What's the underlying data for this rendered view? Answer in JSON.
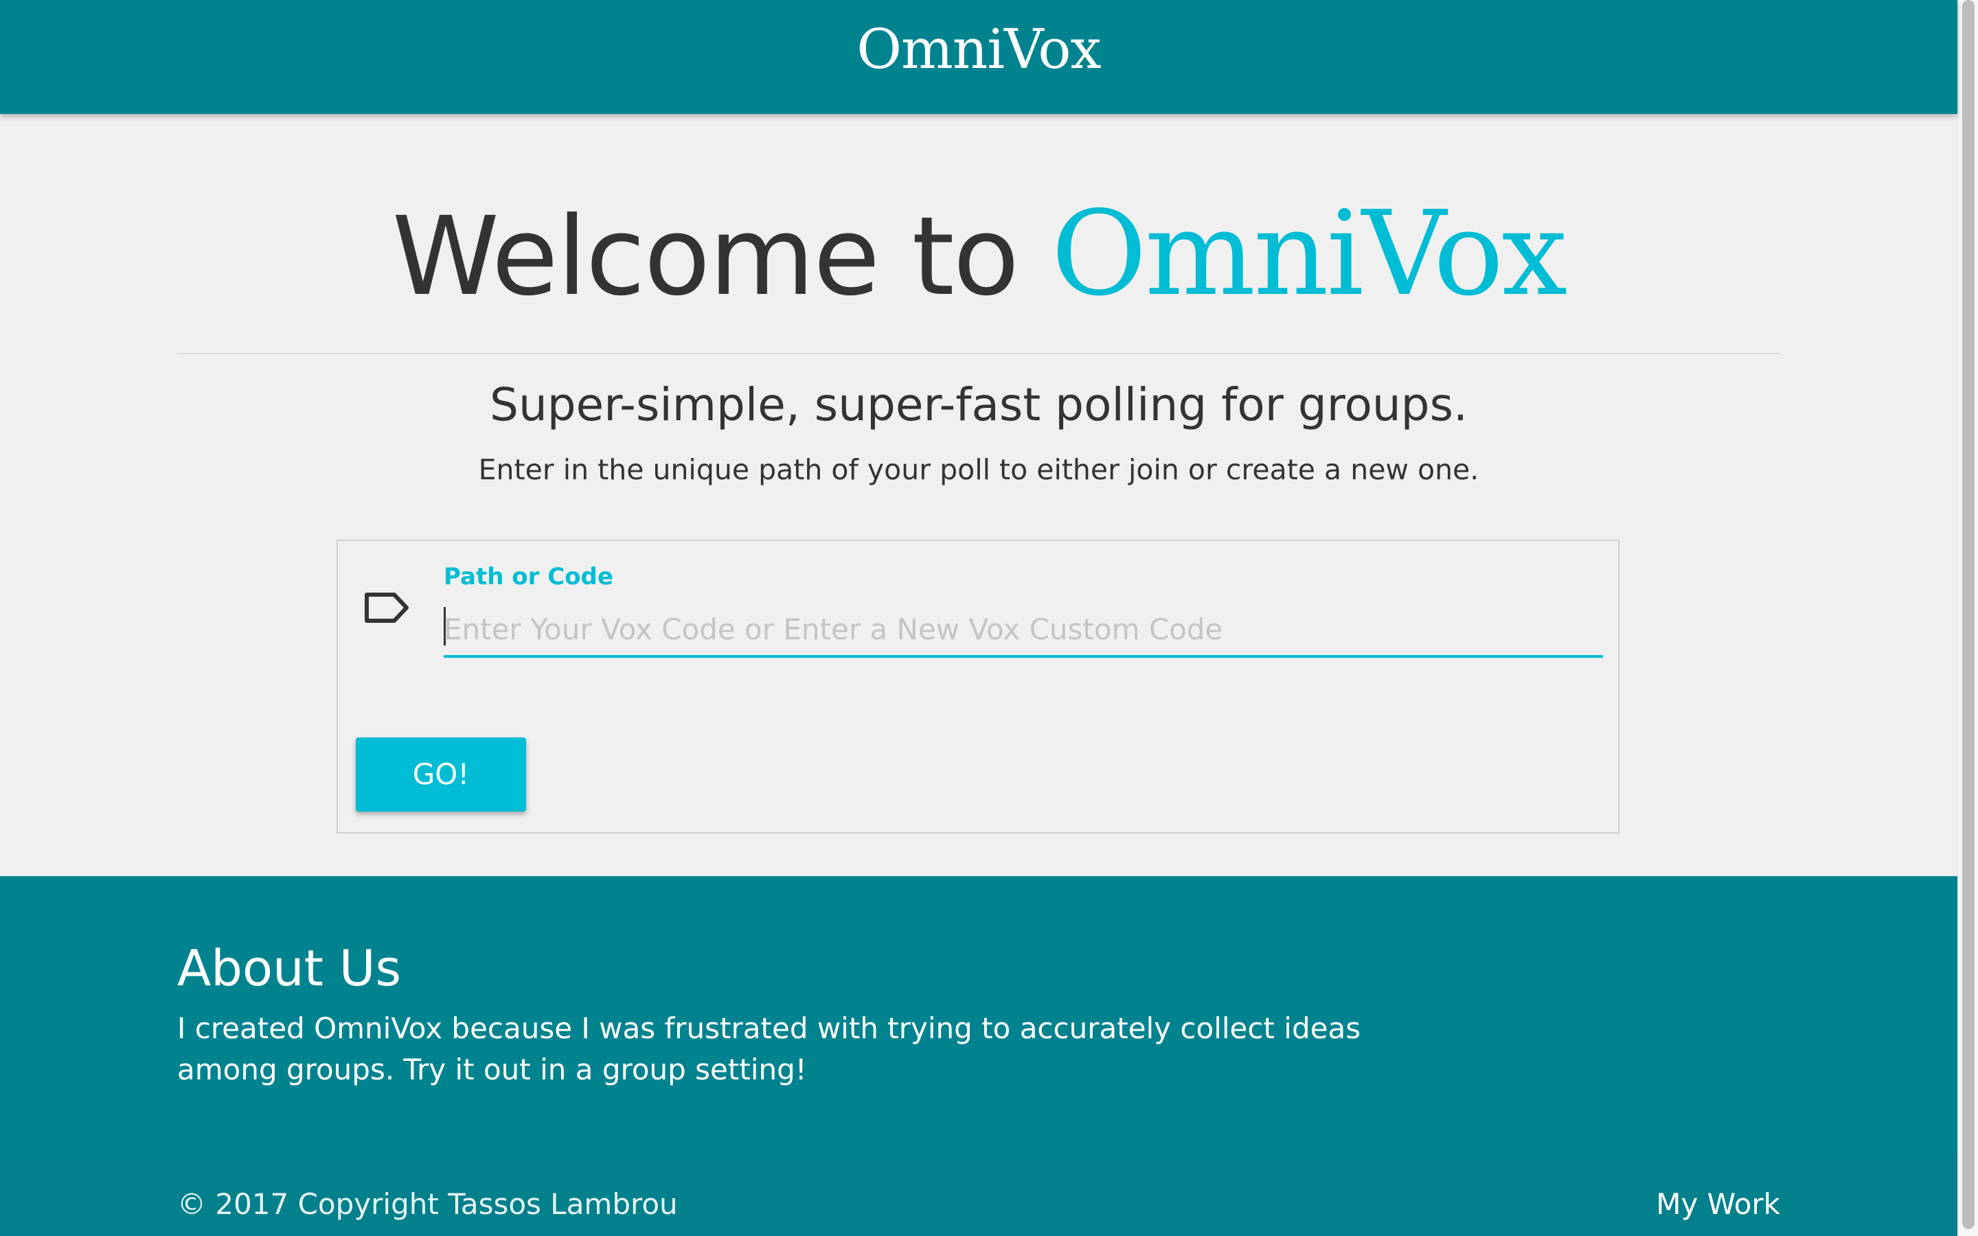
{
  "header": {
    "brand": "OmniVox"
  },
  "hero": {
    "welcome_prefix": "Welcome to ",
    "welcome_brand": "OmniVox",
    "tagline": "Super-simple, super-fast polling for groups.",
    "instructions": "Enter in the unique path of your poll to either join or create a new one."
  },
  "form": {
    "icon": "label-tag-icon",
    "label": "Path or Code",
    "placeholder": "Enter Your Vox Code or Enter a New Vox Custom Code",
    "value": "",
    "button_label": "GO!"
  },
  "about": {
    "title": "About Us",
    "text": "I created OmniVox because I was frustrated with trying to accurately collect ideas among groups. Try it out in a group setting!"
  },
  "footer": {
    "copyright": "© 2017 Copyright Tassos Lambrou",
    "link": "My Work"
  },
  "colors": {
    "primary": "#00838f",
    "accent": "#00bcd4",
    "background": "#f0f0f0",
    "text": "#333333"
  }
}
